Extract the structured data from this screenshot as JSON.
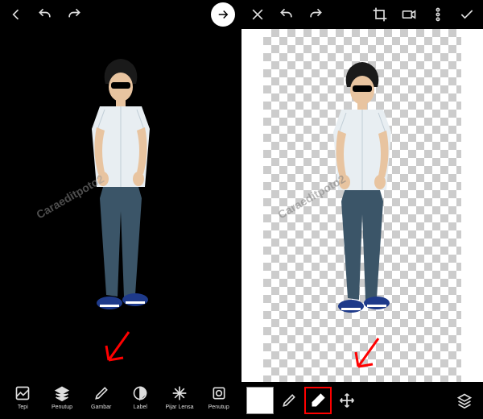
{
  "left": {
    "tools": [
      {
        "label": "Tepi"
      },
      {
        "label": "Penutup"
      },
      {
        "label": "Gambar"
      },
      {
        "label": "Label"
      },
      {
        "label": "Pijar Lensa"
      },
      {
        "label": "Penutup"
      }
    ]
  },
  "watermark": "Caraeditpoto2"
}
